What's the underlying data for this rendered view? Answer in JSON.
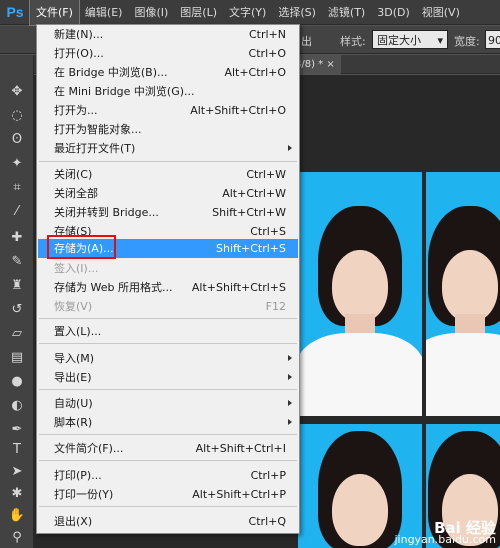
{
  "menubar": {
    "logo": "Ps",
    "items": [
      "文件(F)",
      "编辑(E)",
      "图像(I)",
      "图层(L)",
      "文字(Y)",
      "选择(S)",
      "滤镜(T)",
      "3D(D)",
      "视图(V)"
    ]
  },
  "options": {
    "partial_text": "出",
    "style_label": "样式:",
    "style_value": "固定大小",
    "width_label": "宽度:",
    "width_value": "90"
  },
  "tab": {
    "title": "8/8) * ×"
  },
  "file_menu": {
    "items": [
      {
        "label": "新建(N)...",
        "shortcut": "Ctrl+N"
      },
      {
        "label": "打开(O)...",
        "shortcut": "Ctrl+O"
      },
      {
        "label": "在 Bridge 中浏览(B)...",
        "shortcut": "Alt+Ctrl+O"
      },
      {
        "label": "在 Mini Bridge 中浏览(G)...",
        "shortcut": ""
      },
      {
        "label": "打开为...",
        "shortcut": "Alt+Shift+Ctrl+O"
      },
      {
        "label": "打开为智能对象...",
        "shortcut": ""
      },
      {
        "label": "最近打开文件(T)",
        "shortcut": ""
      },
      {
        "label": "关闭(C)",
        "shortcut": "Ctrl+W"
      },
      {
        "label": "关闭全部",
        "shortcut": "Alt+Ctrl+W"
      },
      {
        "label": "关闭并转到 Bridge...",
        "shortcut": "Shift+Ctrl+W"
      },
      {
        "label": "存储(S)",
        "shortcut": "Ctrl+S"
      },
      {
        "label": "存储为(A)...",
        "shortcut": "Shift+Ctrl+S"
      },
      {
        "label": "签入(I)...",
        "shortcut": ""
      },
      {
        "label": "存储为 Web 所用格式...",
        "shortcut": "Alt+Shift+Ctrl+S"
      },
      {
        "label": "恢复(V)",
        "shortcut": "F12"
      },
      {
        "label": "置入(L)...",
        "shortcut": ""
      },
      {
        "label": "导入(M)",
        "shortcut": ""
      },
      {
        "label": "导出(E)",
        "shortcut": ""
      },
      {
        "label": "自动(U)",
        "shortcut": ""
      },
      {
        "label": "脚本(R)",
        "shortcut": ""
      },
      {
        "label": "文件简介(F)...",
        "shortcut": "Alt+Shift+Ctrl+I"
      },
      {
        "label": "打印(P)...",
        "shortcut": "Ctrl+P"
      },
      {
        "label": "打印一份(Y)",
        "shortcut": "Alt+Shift+Ctrl+P"
      },
      {
        "label": "退出(X)",
        "shortcut": "Ctrl+Q"
      }
    ]
  },
  "watermark": {
    "logo": "Bai 经验",
    "url": "jingyan.baidu.com"
  },
  "colors": {
    "highlight": "#3399ff",
    "photo_bg": "#1fb3f0",
    "annotation": "#e01010"
  }
}
